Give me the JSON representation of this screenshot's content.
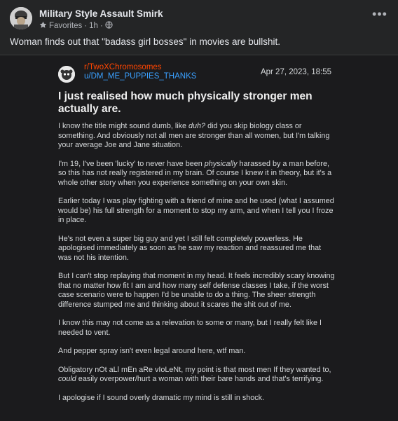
{
  "header": {
    "group_name": "Military Style Assault Smirk",
    "favorites_label": "Favorites",
    "time": "1h"
  },
  "caption": "Woman finds out that \"badass girl bosses\" in movies are bullshit.",
  "screenshot": {
    "subreddit": "r/TwoXChromosomes",
    "username": "u/DM_ME_PUPPIES_THANKS",
    "date": "Apr 27, 2023, 18:55",
    "title": "I just realised how much physically stronger men actually are.",
    "paragraphs": [
      {
        "parts": [
          {
            "t": "I know the title might sound dumb, like "
          },
          {
            "t": "duh?",
            "i": true
          },
          {
            "t": " did you skip biology class or something. And obviously not all men are stronger than all women, but I'm talking your average Joe and Jane situation."
          }
        ]
      },
      {
        "parts": [
          {
            "t": "I'm 19, I've been 'lucky' to never have been "
          },
          {
            "t": "physically",
            "i": true
          },
          {
            "t": " harassed by a man before, so this has not really registered in my brain. Of course I knew it in theory, but it's a whole other story when you experience something on your own skin."
          }
        ]
      },
      {
        "parts": [
          {
            "t": "Earlier today I was play fighting with a friend of mine and he used (what I assumed would be) his full strength for a moment to stop my arm, and when I tell you I froze in place."
          }
        ]
      },
      {
        "parts": [
          {
            "t": "He's not even a super big guy and yet I still felt completely powerless. He apologised immediately as soon as he saw my reaction and reassured me that was not his intention."
          }
        ]
      },
      {
        "parts": [
          {
            "t": "But I can't stop replaying that moment in my head. It feels incredibly scary knowing that no matter how fit I am and how many self defense classes I take, if the worst case scenario were to happen I'd be unable to do a thing. The sheer strength difference stumped me and thinking about it scares the shit out of me."
          }
        ]
      },
      {
        "parts": [
          {
            "t": "I know this may not come as a relevation to some or many, but I really felt like I needed to vent."
          }
        ]
      },
      {
        "parts": [
          {
            "t": "And pepper spray isn't even legal around here, wtf man."
          }
        ]
      },
      {
        "parts": [
          {
            "t": "Obligatory nOt aLl mEn aRe vIoLeNt, my point is that most men If they wanted to, "
          },
          {
            "t": "could",
            "i": true
          },
          {
            "t": " easily overpower/hurt a woman with their bare hands and that's terrifying."
          }
        ]
      },
      {
        "parts": [
          {
            "t": "I apologise if I sound overly dramatic my mind is still in shock."
          }
        ]
      }
    ]
  },
  "icons": {
    "more": "more-options-icon",
    "globe": "globe-icon",
    "favorite": "favorite-star-icon"
  }
}
